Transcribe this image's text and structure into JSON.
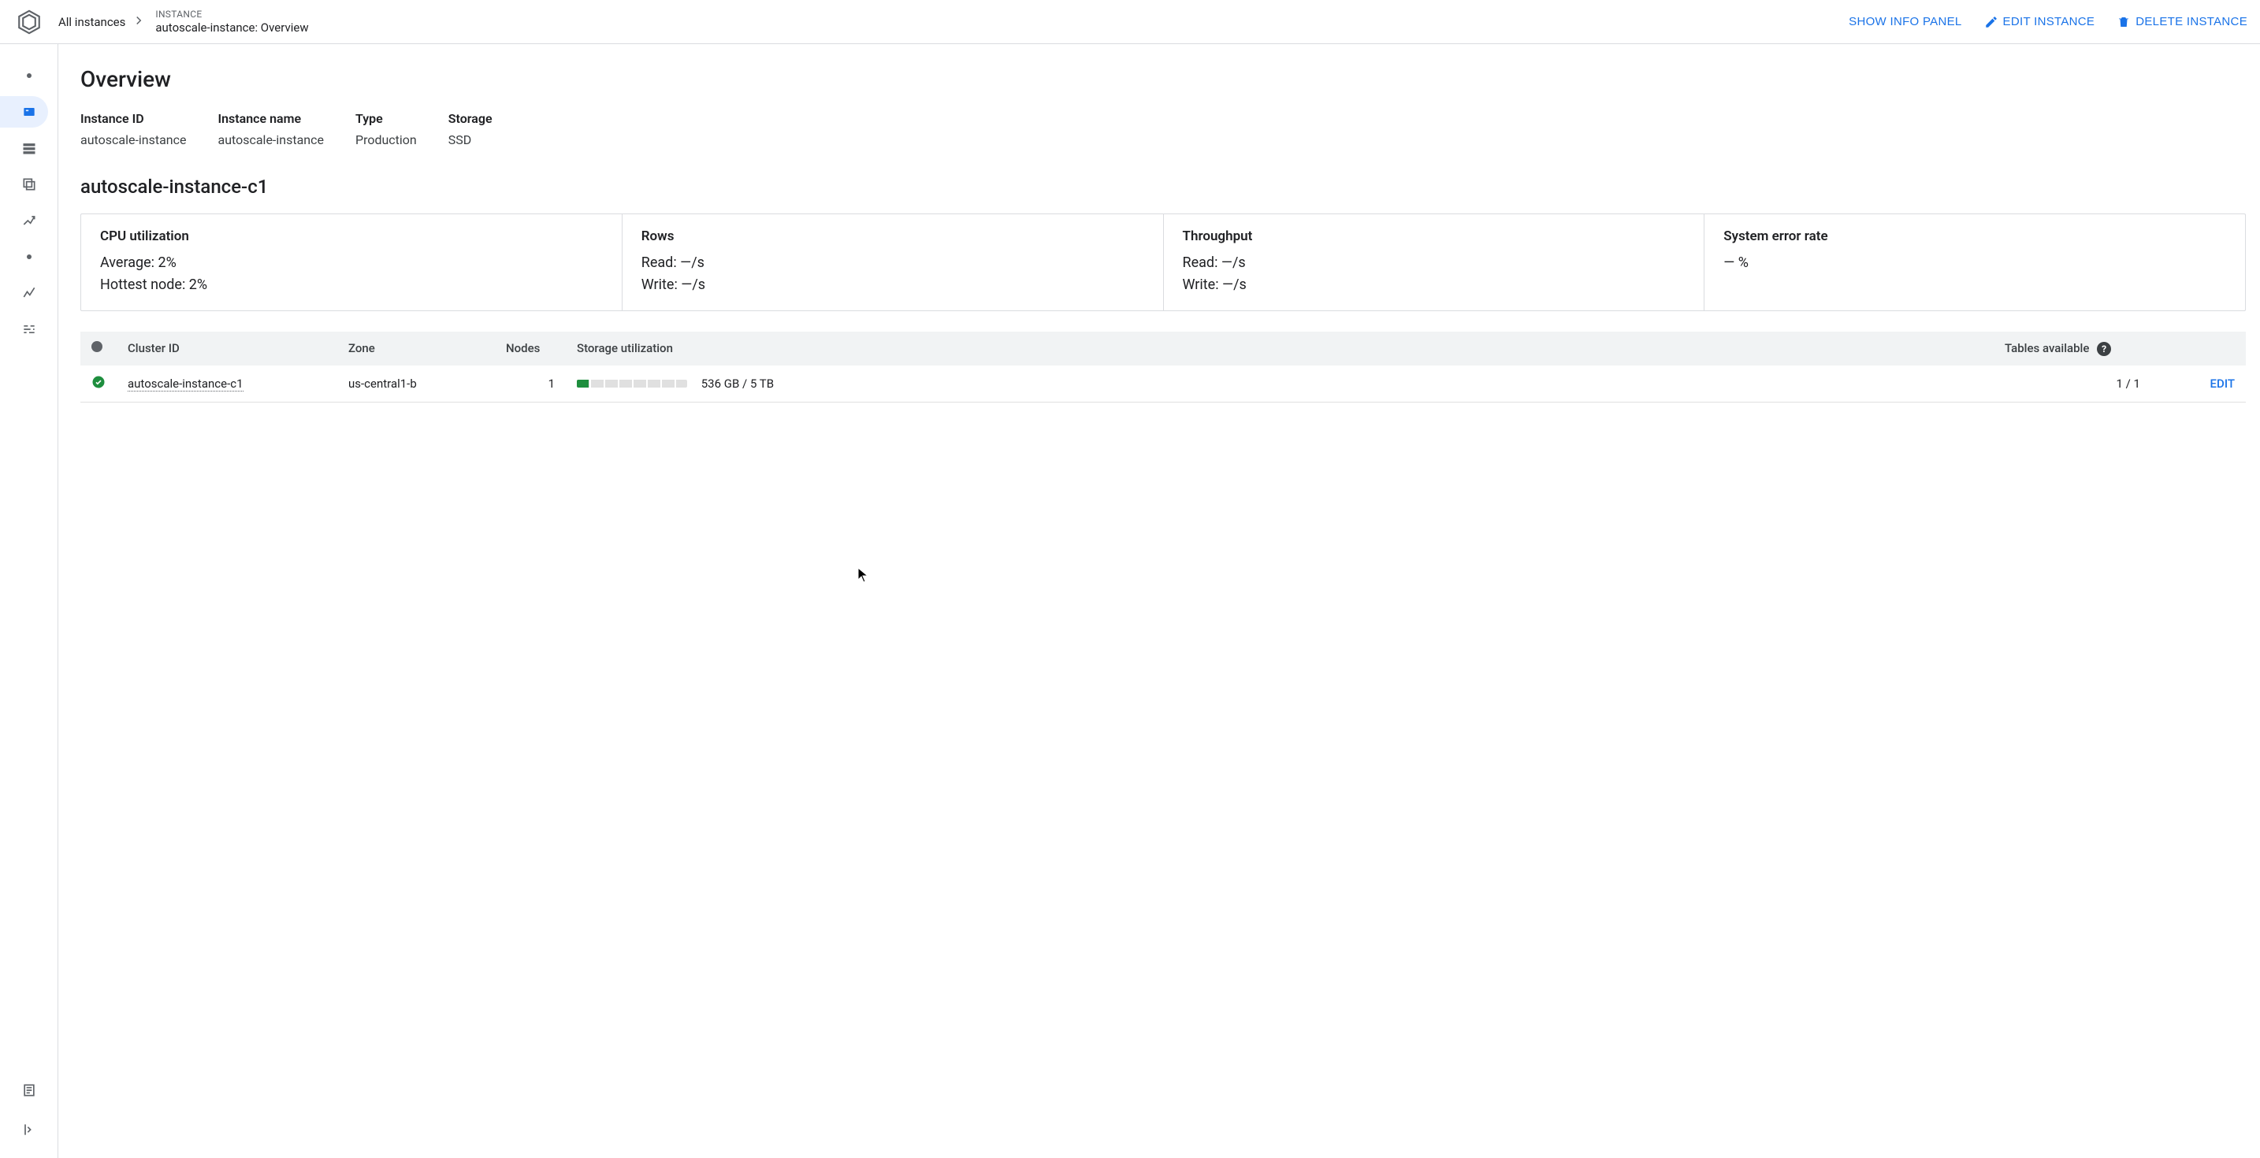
{
  "header": {
    "breadcrumb_root": "All instances",
    "eyebrow": "INSTANCE",
    "title": "autoscale-instance: Overview",
    "actions": {
      "show_info": "SHOW INFO PANEL",
      "edit": "EDIT INSTANCE",
      "delete": "DELETE INSTANCE"
    }
  },
  "page": {
    "title": "Overview"
  },
  "instance": {
    "labels": {
      "id": "Instance ID",
      "name": "Instance name",
      "type": "Type",
      "storage": "Storage"
    },
    "id": "autoscale-instance",
    "name": "autoscale-instance",
    "type": "Production",
    "storage": "SSD"
  },
  "cluster": {
    "title": "autoscale-instance-c1",
    "metrics": {
      "cpu": {
        "title": "CPU utilization",
        "avg": "Average: 2%",
        "hot": "Hottest node: 2%"
      },
      "rows": {
        "title": "Rows",
        "read": "Read: —/s",
        "write": "Write: —/s"
      },
      "throughput": {
        "title": "Throughput",
        "read": "Read: —/s",
        "write": "Write: —/s"
      },
      "error": {
        "title": "System error rate",
        "value": "— %"
      }
    }
  },
  "table": {
    "headers": {
      "cluster_id": "Cluster ID",
      "zone": "Zone",
      "nodes": "Nodes",
      "storage_util": "Storage utilization",
      "tables_avail": "Tables available"
    },
    "row": {
      "cluster_id": "autoscale-instance-c1",
      "zone": "us-central1-b",
      "nodes": "1",
      "storage_util_text": "536 GB / 5 TB",
      "storage_util_pct": 11,
      "tables_avail": "1 / 1",
      "edit": "EDIT"
    }
  }
}
